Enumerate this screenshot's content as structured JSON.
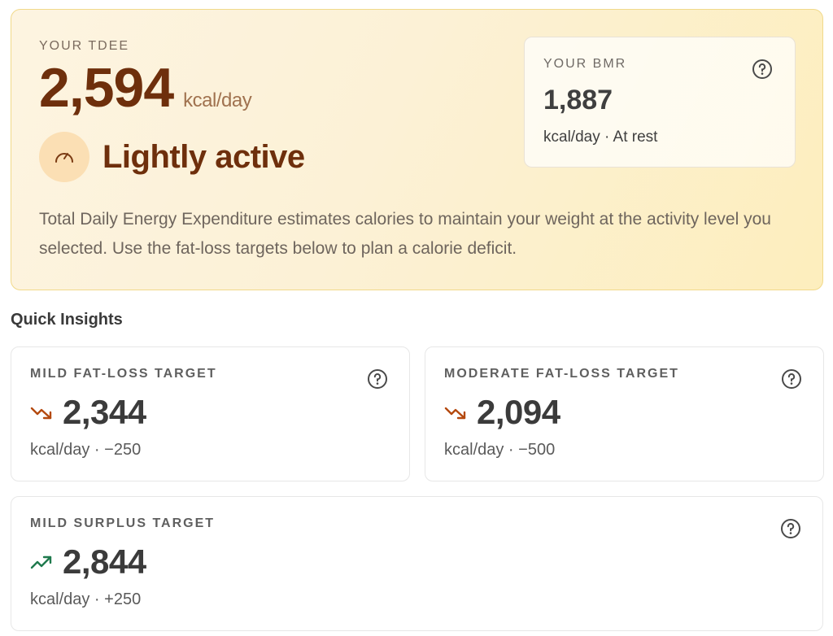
{
  "hero": {
    "label": "YOUR TDEE",
    "value": "2,594",
    "unit": "kcal/day",
    "activity_label": "Lightly active",
    "activity_icon": "gauge-icon",
    "description": "Total Daily Energy Expenditure estimates calories to maintain your weight at the activity level you selected. Use the fat-loss targets below to plan a calorie deficit."
  },
  "bmr": {
    "label": "YOUR BMR",
    "value": "1,887",
    "sub": "kcal/day · At rest"
  },
  "insights": {
    "title": "Quick Insights",
    "cards": [
      {
        "label": "MILD FAT-LOSS TARGET",
        "value": "2,344",
        "sub": "kcal/day · −250",
        "trend": "down",
        "trend_color": "#b4490f"
      },
      {
        "label": "MODERATE FAT-LOSS TARGET",
        "value": "2,094",
        "sub": "kcal/day · −500",
        "trend": "down",
        "trend_color": "#b4490f"
      },
      {
        "label": "MILD SURPLUS TARGET",
        "value": "2,844",
        "sub": "kcal/day · +250",
        "trend": "up",
        "trend_color": "#1f7a4d"
      }
    ]
  },
  "colors": {
    "accent": "#6e2f0c",
    "hero_border": "#f1d98a",
    "badge_bg": "#fbdfb4"
  }
}
